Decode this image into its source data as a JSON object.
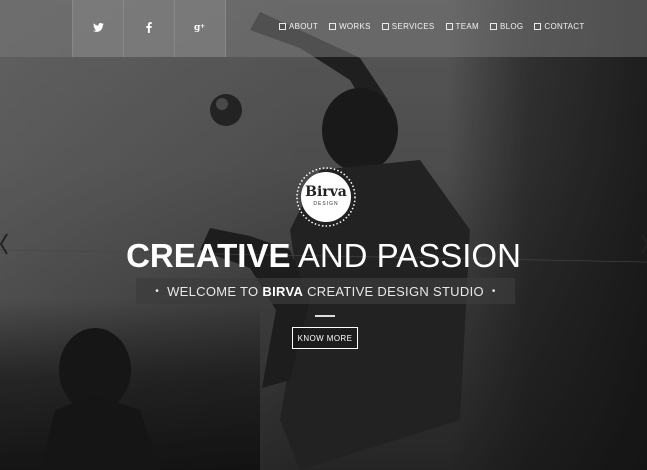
{
  "social": [
    {
      "name": "twitter",
      "icon": "twitter-icon",
      "glyph": "𝕥"
    },
    {
      "name": "facebook",
      "icon": "facebook-icon",
      "glyph": "f"
    },
    {
      "name": "google-plus",
      "icon": "google-plus-icon",
      "glyph": "g+"
    }
  ],
  "nav": {
    "items": [
      "ABOUT",
      "WORKS",
      "SERVICES",
      "TEAM",
      "BLOG",
      "CONTACT"
    ]
  },
  "logo": {
    "name": "Birva",
    "sub": "DESIGN"
  },
  "hero": {
    "headline_bold": "CREATIVE",
    "headline_light": "AND PASSION",
    "tagline_pre": "WELCOME TO ",
    "tagline_bold": "BIRVA",
    "tagline_post": " CREATIVE DESIGN STUDIO",
    "tagline_bullet": "•",
    "cta_label": "KNOW MORE"
  },
  "colors": {
    "text": "#ffffff",
    "topbar": "#787878"
  }
}
